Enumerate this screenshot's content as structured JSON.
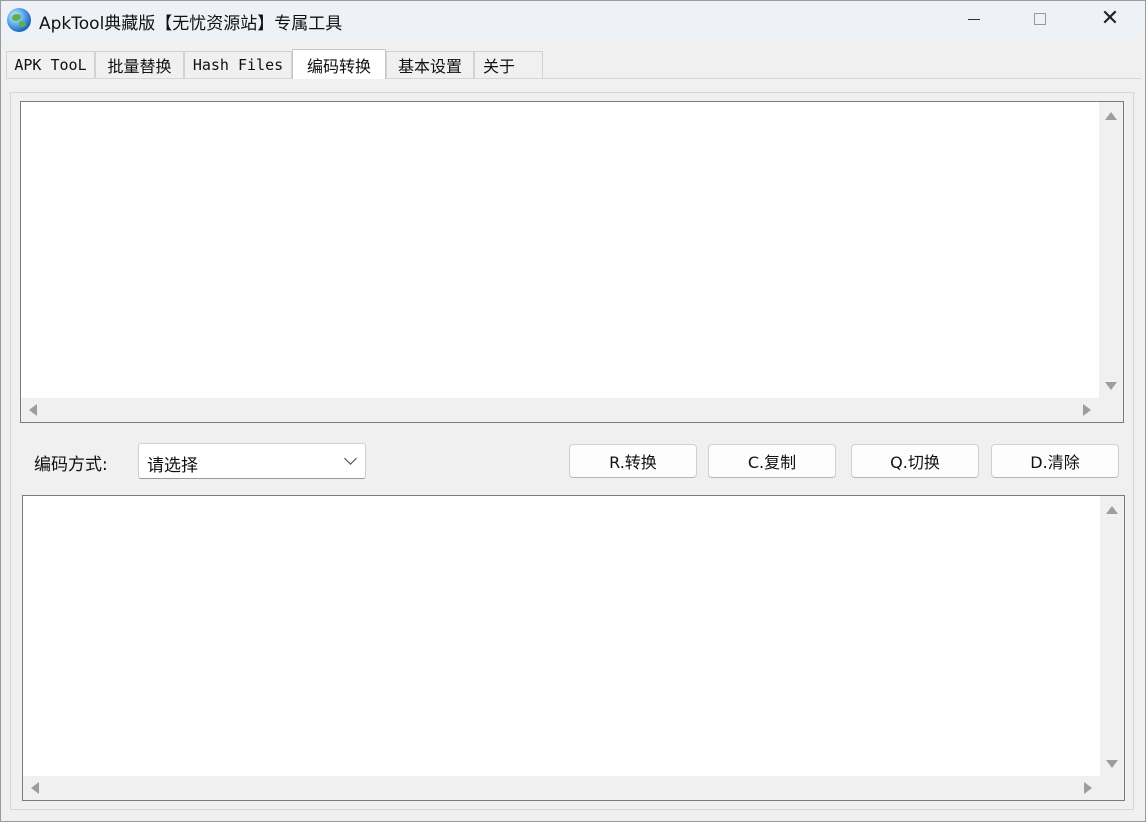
{
  "window": {
    "title": "ApkTool典藏版【无忧资源站】专属工具",
    "controls": {
      "minimize": "minimize",
      "maximize": "maximize",
      "close": "✕"
    }
  },
  "tabs": [
    {
      "label": "APK TooL",
      "active": false
    },
    {
      "label": "批量替换",
      "active": false
    },
    {
      "label": "Hash Files",
      "active": false
    },
    {
      "label": "编码转换",
      "active": true
    },
    {
      "label": "基本设置",
      "active": false
    },
    {
      "label": "关于",
      "active": false
    }
  ],
  "encoding": {
    "label": "编码方式:",
    "selected": "请选择"
  },
  "buttons": {
    "convert": "R.转换",
    "copy": "C.复制",
    "switch": "Q.切换",
    "clear": "D.清除"
  },
  "input_text": "",
  "output_text": ""
}
